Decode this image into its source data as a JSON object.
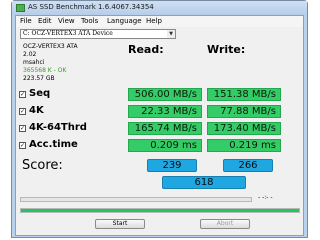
{
  "window": {
    "title": "AS SSD Benchmark 1.6.4067.34354"
  },
  "menu": {
    "items": [
      "File",
      "Edit",
      "View",
      "Tools",
      "Language",
      "Help"
    ]
  },
  "drive": {
    "selected": "C: OCZ-VERTEX3 ATA Device",
    "model": "OCZ-VERTEX3 ATA",
    "firmware": "2.02",
    "driver": "msahci",
    "alignment": "365568 K - OK",
    "capacity": "223.57 GB"
  },
  "columns": {
    "read": "Read:",
    "write": "Write:"
  },
  "tests": [
    {
      "label": "Seq",
      "read": "506.00 MB/s",
      "write": "151.38 MB/s",
      "checked": true
    },
    {
      "label": "4K",
      "read": "22.33 MB/s",
      "write": "77.88 MB/s",
      "checked": true
    },
    {
      "label": "4K-64Thrd",
      "read": "165.74 MB/s",
      "write": "173.40 MB/s",
      "checked": true
    },
    {
      "label": "Acc.time",
      "read": "0.209 ms",
      "write": "0.219 ms",
      "checked": true
    }
  ],
  "score": {
    "label": "Score:",
    "read": "239",
    "write": "266",
    "total": "618"
  },
  "progress": {
    "time_text": "- -:- -",
    "bar1_fraction": 0.0,
    "bar2_fraction": 1.0
  },
  "buttons": {
    "start": "Start",
    "abort": "Abort"
  },
  "colors": {
    "result_green": "#33cc66",
    "score_blue": "#1ea7e1",
    "alignment_ok": "#3a9a2a"
  }
}
